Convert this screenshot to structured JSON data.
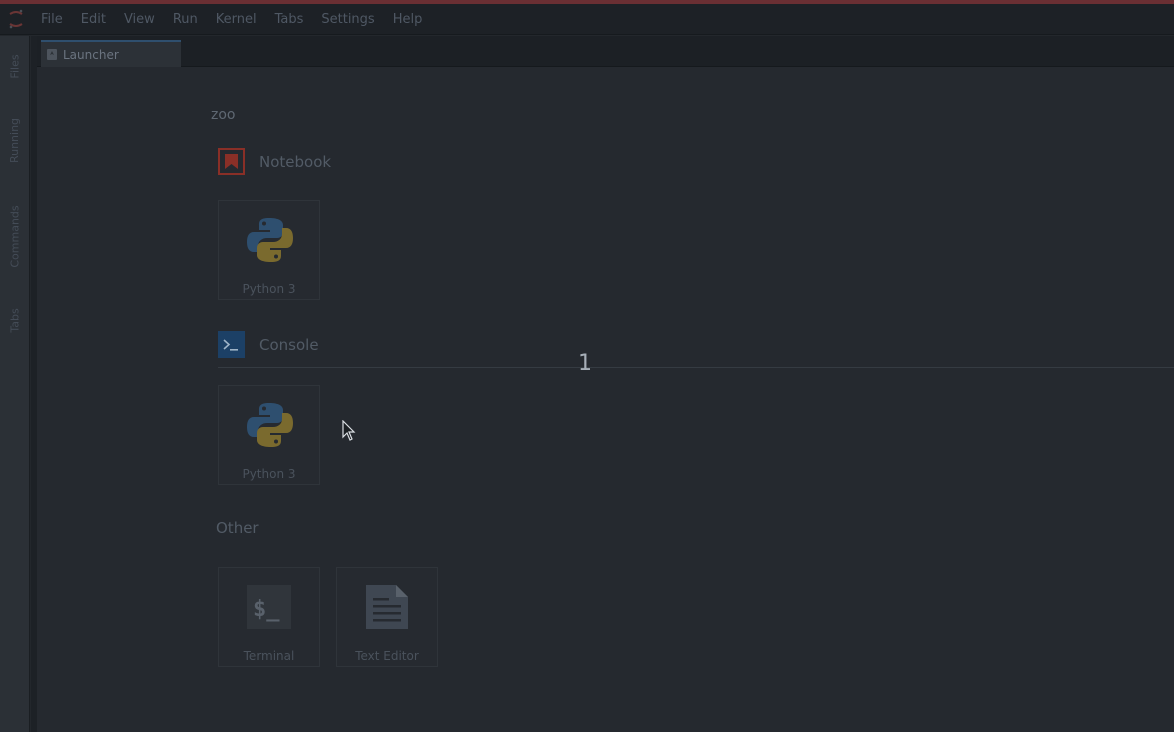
{
  "menubar": {
    "items": [
      "File",
      "Edit",
      "View",
      "Run",
      "Kernel",
      "Tabs",
      "Settings",
      "Help"
    ]
  },
  "left_tabs": [
    "Files",
    "Running",
    "Commands",
    "Tabs"
  ],
  "doc_tabs": [
    {
      "label": "Launcher",
      "icon": "rocket-icon"
    }
  ],
  "launcher": {
    "cwd": "zoo",
    "sections": {
      "notebook": {
        "title": "Notebook",
        "icon": "notebook-icon",
        "cards": [
          "Python 3"
        ]
      },
      "console": {
        "title": "Console",
        "icon": "console-icon",
        "cards": [
          "Python 3"
        ]
      },
      "other": {
        "title": "Other",
        "cards": [
          "Terminal",
          "Text Editor"
        ]
      }
    }
  },
  "overlay": {
    "slide_number": "1"
  },
  "colors": {
    "accent_top": "#6a2f33",
    "notebook_icon": "#c0392b",
    "console_icon": "#1f5c9a",
    "background": "#25292f"
  }
}
